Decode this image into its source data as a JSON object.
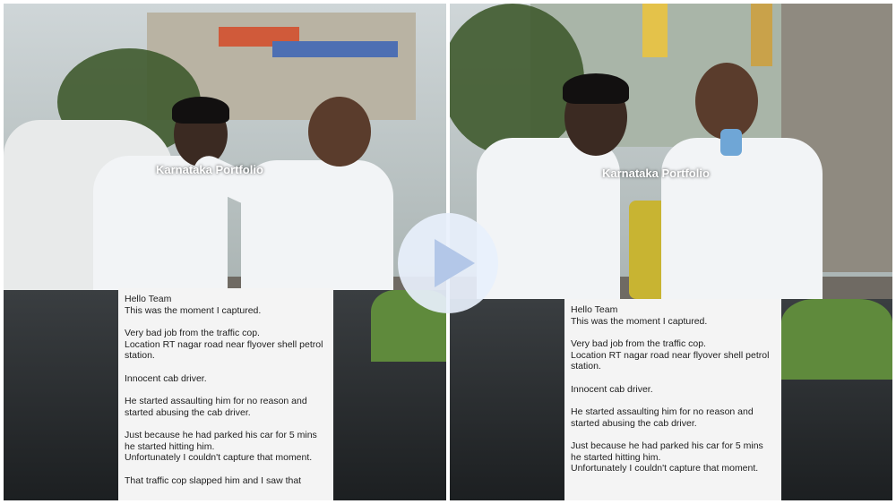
{
  "watermark_text": "Karnataka Portfolio",
  "note": {
    "greeting": "Hello Team",
    "lines": [
      "This was the moment I captured.",
      "Very bad job from the traffic cop.\nLocation RT nagar road near flyover shell petrol station.",
      "Innocent cab driver.",
      "He started assaulting him for no reason and started abusing the cab driver.",
      "Just because he had parked his car for 5 mins he started hitting him.\nUnfortunately I couldn't capture that moment.",
      "That traffic cop slapped him and I saw that"
    ]
  },
  "play_button": {
    "icon": "play-icon",
    "accent": "#b3c7e8"
  },
  "colors": {
    "card_bg": "#f4f4f4",
    "watermark": "#ffffff"
  }
}
